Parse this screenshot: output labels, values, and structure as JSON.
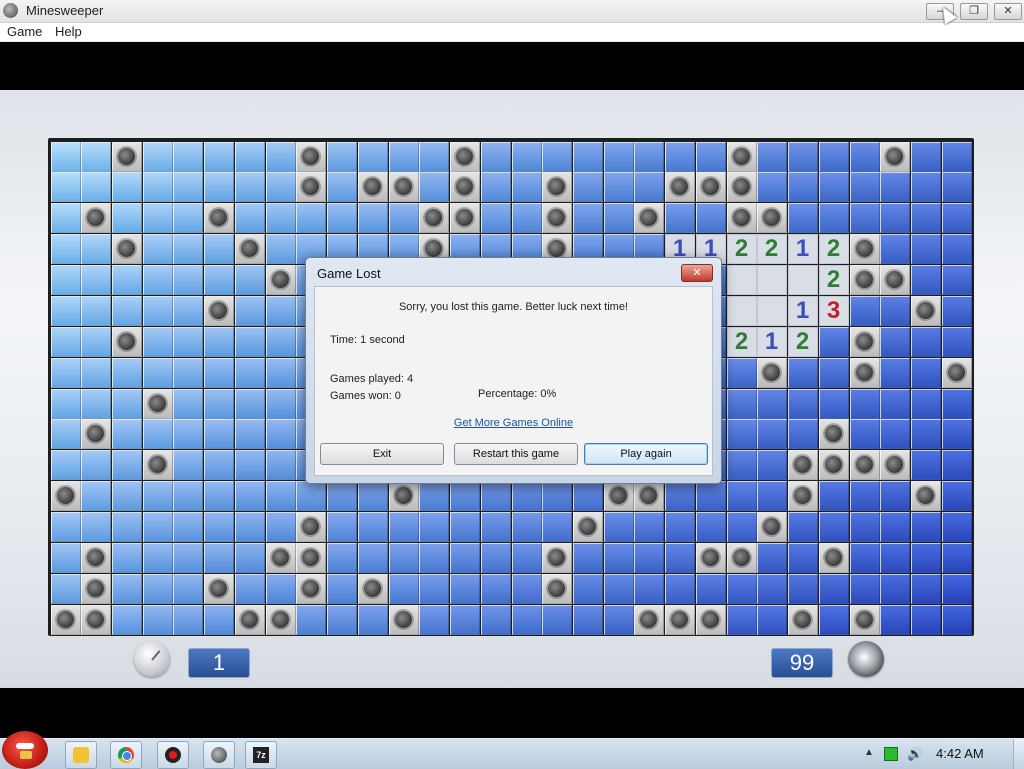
{
  "window": {
    "title": "Minesweeper",
    "controls": {
      "minimize": "‒",
      "maximize": "❐",
      "close": "✕"
    }
  },
  "menu": {
    "game": "Game",
    "help": "Help"
  },
  "board": {
    "cols": 30,
    "rows": 16,
    "mines": [
      [
        0,
        2
      ],
      [
        0,
        8
      ],
      [
        0,
        13
      ],
      [
        0,
        22
      ],
      [
        0,
        27
      ],
      [
        1,
        8
      ],
      [
        1,
        10
      ],
      [
        1,
        11
      ],
      [
        1,
        13
      ],
      [
        1,
        16
      ],
      [
        1,
        20
      ],
      [
        1,
        21
      ],
      [
        1,
        22
      ],
      [
        2,
        1
      ],
      [
        2,
        5
      ],
      [
        2,
        12
      ],
      [
        2,
        13
      ],
      [
        2,
        16
      ],
      [
        2,
        19
      ],
      [
        2,
        22
      ],
      [
        2,
        23
      ],
      [
        3,
        2
      ],
      [
        3,
        6
      ],
      [
        3,
        12
      ],
      [
        3,
        16
      ],
      [
        3,
        26
      ],
      [
        4,
        7
      ],
      [
        4,
        26
      ],
      [
        4,
        27
      ],
      [
        5,
        5
      ],
      [
        5,
        28
      ],
      [
        6,
        2
      ],
      [
        6,
        26
      ],
      [
        7,
        23
      ],
      [
        7,
        26
      ],
      [
        7,
        29
      ],
      [
        8,
        3
      ],
      [
        9,
        1
      ],
      [
        9,
        25
      ],
      [
        10,
        3
      ],
      [
        10,
        24
      ],
      [
        10,
        25
      ],
      [
        10,
        26
      ],
      [
        10,
        27
      ],
      [
        11,
        0
      ],
      [
        11,
        11
      ],
      [
        11,
        18
      ],
      [
        11,
        19
      ],
      [
        11,
        24
      ],
      [
        11,
        28
      ],
      [
        12,
        8
      ],
      [
        12,
        17
      ],
      [
        12,
        23
      ],
      [
        13,
        1
      ],
      [
        13,
        7
      ],
      [
        13,
        8
      ],
      [
        13,
        16
      ],
      [
        13,
        21
      ],
      [
        13,
        22
      ],
      [
        13,
        25
      ],
      [
        14,
        1
      ],
      [
        14,
        5
      ],
      [
        14,
        8
      ],
      [
        14,
        10
      ],
      [
        14,
        16
      ],
      [
        15,
        0
      ],
      [
        15,
        1
      ],
      [
        15,
        6
      ],
      [
        15,
        7
      ],
      [
        15,
        11
      ],
      [
        15,
        19
      ],
      [
        15,
        20
      ],
      [
        15,
        21
      ],
      [
        15,
        24
      ],
      [
        15,
        26
      ]
    ],
    "open_cells": [
      [
        4,
        22
      ],
      [
        4,
        23
      ],
      [
        4,
        24
      ],
      [
        5,
        22
      ],
      [
        5,
        23
      ]
    ],
    "numbers": [
      {
        "r": 3,
        "c": 20,
        "v": "1"
      },
      {
        "r": 3,
        "c": 21,
        "v": "1"
      },
      {
        "r": 3,
        "c": 22,
        "v": "2"
      },
      {
        "r": 3,
        "c": 23,
        "v": "2"
      },
      {
        "r": 3,
        "c": 24,
        "v": "1"
      },
      {
        "r": 3,
        "c": 25,
        "v": "2"
      },
      {
        "r": 4,
        "c": 25,
        "v": "2"
      },
      {
        "r": 5,
        "c": 24,
        "v": "1"
      },
      {
        "r": 5,
        "c": 25,
        "v": "3"
      },
      {
        "r": 6,
        "c": 22,
        "v": "2"
      },
      {
        "r": 6,
        "c": 23,
        "v": "1"
      },
      {
        "r": 6,
        "c": 24,
        "v": "2"
      }
    ],
    "number_colors": {
      "1": "#3a4fbf",
      "2": "#2f7d32",
      "3": "#c0202a"
    }
  },
  "counters": {
    "time": "1",
    "mines": "99"
  },
  "dialog": {
    "title": "Game Lost",
    "close": "✕",
    "message": "Sorry, you lost this game. Better luck next time!",
    "time": "Time: 1 second",
    "games_played": "Games played: 4",
    "games_won": "Games won: 0",
    "percentage": "Percentage: 0%",
    "link": "Get More Games Online",
    "buttons": {
      "exit": "Exit",
      "restart": "Restart this game",
      "play_again": "Play again"
    }
  },
  "taskbar": {
    "apps": [
      {
        "name": "explorer-icon",
        "label": ""
      },
      {
        "name": "chrome-icon",
        "label": ""
      },
      {
        "name": "record-icon",
        "label": ""
      },
      {
        "name": "minesweeper-icon",
        "label": ""
      },
      {
        "name": "7zip-icon",
        "label": "7z"
      }
    ],
    "tray_up": "▲",
    "volume": "🔊",
    "clock": "4:42 AM"
  }
}
